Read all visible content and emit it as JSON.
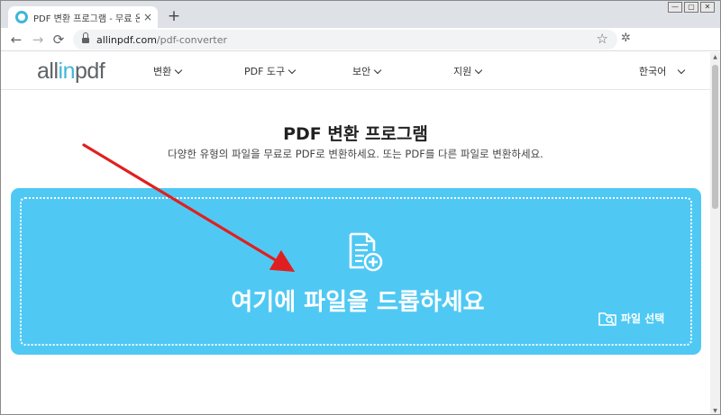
{
  "browser": {
    "tab_title": "PDF 변환 프로그램 - 무료 온라인",
    "tab_close": "×",
    "new_tab": "+",
    "url_host": "allinpdf.com",
    "url_path": "/pdf-converter",
    "back": "←",
    "forward": "→",
    "reload": "⟳",
    "star": "☆",
    "extensions": "✲",
    "minimize": "—",
    "maximize": "▢",
    "close": "✕"
  },
  "site": {
    "logo_part1": "all",
    "logo_accent": "in",
    "logo_part2": "pdf",
    "menu": [
      {
        "label": "변환"
      },
      {
        "label": "PDF 도구"
      },
      {
        "label": "보안"
      },
      {
        "label": "지원"
      }
    ],
    "language": "한국어"
  },
  "hero": {
    "title": "PDF 변환 프로그램",
    "subtitle": "다양한 유형의 파일을 무료로 PDF로 변환하세요. 또는 PDF를 다른 파일로 변환하세요."
  },
  "dropzone": {
    "text": "여기에 파일을 드롭하세요",
    "select_label": "파일 선택"
  },
  "colors": {
    "brand": "#3fb6d8",
    "dropzone": "#4fc9f4",
    "annotation_arrow": "#e02020"
  }
}
